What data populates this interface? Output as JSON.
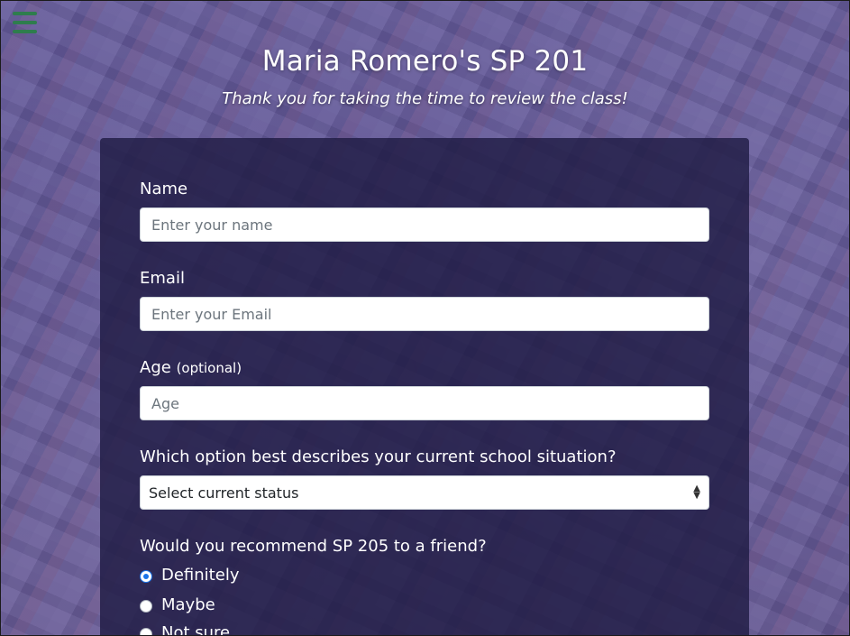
{
  "header": {
    "title": "Maria Romero's SP 201",
    "subtitle": "Thank you for taking the time to review the class!"
  },
  "menu": {
    "icon": "hamburger-menu-icon"
  },
  "form": {
    "name": {
      "label": "Name",
      "placeholder": "Enter your name",
      "value": ""
    },
    "email": {
      "label": "Email",
      "placeholder": "Enter your Email",
      "value": ""
    },
    "age": {
      "label": "Age",
      "optional": "(optional)",
      "placeholder": "Age",
      "value": ""
    },
    "status": {
      "label": "Which option best describes your current school situation?",
      "selected": "Select current status",
      "icon": "select-arrows-icon"
    },
    "recommend": {
      "label": "Would you recommend SP 205 to a friend?",
      "options": [
        {
          "label": "Definitely",
          "checked": true
        },
        {
          "label": "Maybe",
          "checked": false
        },
        {
          "label": "Not sure",
          "checked": false
        }
      ]
    }
  },
  "colors": {
    "accent": "#1a73e8",
    "menu_icon": "#2e7d4d",
    "card_bg": "#1e1a42",
    "tint": "#483c96"
  }
}
